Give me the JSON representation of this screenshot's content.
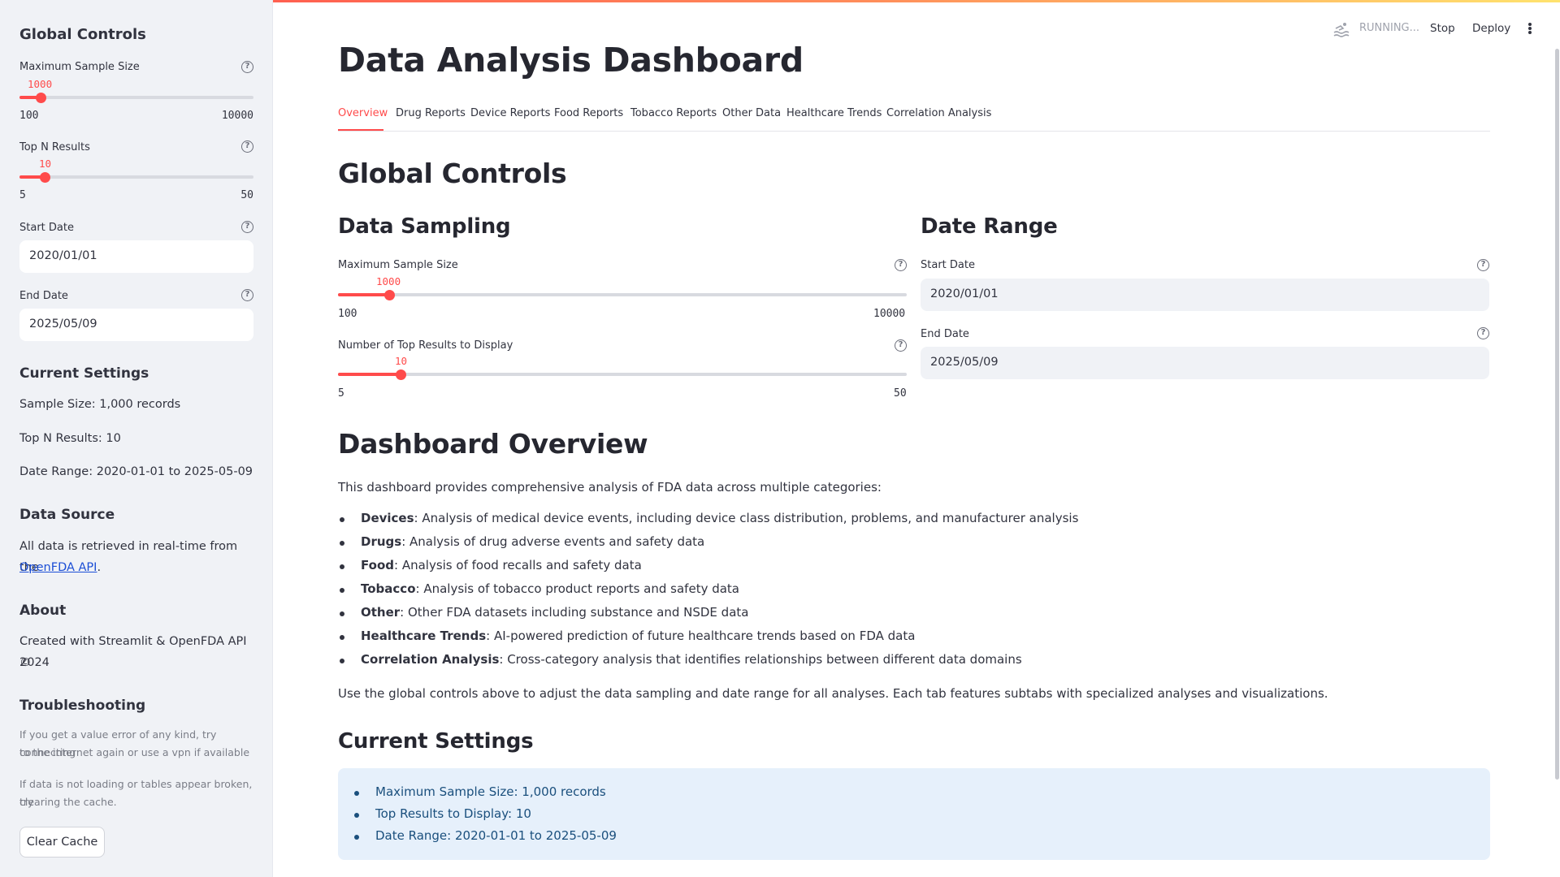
{
  "header": {
    "status": "RUNNING...",
    "stop": "Stop",
    "deploy": "Deploy"
  },
  "sidebar": {
    "title": "Global Controls",
    "max_sample": {
      "label": "Maximum Sample Size",
      "value": "1000",
      "min": "100",
      "max": "10000",
      "fraction": 0.091
    },
    "top_n": {
      "label": "Top N Results",
      "value": "10",
      "min": "5",
      "max": "50",
      "fraction": 0.111
    },
    "start_date": {
      "label": "Start Date",
      "value": "2020/01/01"
    },
    "end_date": {
      "label": "End Date",
      "value": "2025/05/09"
    },
    "current_settings": {
      "title": "Current Settings",
      "sample": "Sample Size: 1,000 records",
      "topn": "Top N Results: 10",
      "range": "Date Range: 2020-01-01 to 2025-05-09"
    },
    "data_source": {
      "title": "Data Source",
      "text": "All data is retrieved in real-time from the",
      "link": "OpenFDA API",
      "after": "."
    },
    "about": {
      "title": "About",
      "line1": "Created with Streamlit & OpenFDA API ©",
      "line2": "2024"
    },
    "troubleshooting": {
      "title": "Troubleshooting",
      "p1a": "If you get a value error of any kind, try connecting",
      "p1b": "to the internet again or use a vpn if available",
      "p2a": "If data is not loading or tables appear broken, try",
      "p2b": "clearing the cache.",
      "button": "Clear Cache"
    }
  },
  "main": {
    "title": "Data Analysis Dashboard",
    "tabs": [
      "Overview",
      "Drug Reports",
      "Device Reports",
      "Food Reports",
      "Tobacco Reports",
      "Other Data",
      "Healthcare Trends",
      "Correlation Analysis"
    ],
    "global_controls": "Global Controls",
    "data_sampling": {
      "title": "Data Sampling",
      "max_sample": {
        "label": "Maximum Sample Size",
        "value": "1000",
        "min": "100",
        "max": "10000",
        "fraction": 0.091
      },
      "top_n": {
        "label": "Number of Top Results to Display",
        "value": "10",
        "min": "5",
        "max": "50",
        "fraction": 0.111
      }
    },
    "date_range": {
      "title": "Date Range",
      "start_label": "Start Date",
      "start_value": "2020/01/01",
      "end_label": "End Date",
      "end_value": "2025/05/09"
    },
    "overview": {
      "title": "Dashboard Overview",
      "intro": "This dashboard provides comprehensive analysis of FDA data across multiple categories:",
      "items": [
        {
          "term": "Devices",
          "desc": ": Analysis of medical device events, including device class distribution, problems, and manufacturer analysis"
        },
        {
          "term": "Drugs",
          "desc": ": Analysis of drug adverse events and safety data"
        },
        {
          "term": "Food",
          "desc": ": Analysis of food recalls and safety data"
        },
        {
          "term": "Tobacco",
          "desc": ": Analysis of tobacco product reports and safety data"
        },
        {
          "term": "Other",
          "desc": ": Other FDA datasets including substance and NSDE data"
        },
        {
          "term": "Healthcare Trends",
          "desc": ": AI-powered prediction of future healthcare trends based on FDA data"
        },
        {
          "term": "Correlation Analysis",
          "desc": ": Cross-category analysis that identifies relationships between different data domains"
        }
      ],
      "outro": "Use the global controls above to adjust the data sampling and date range for all analyses. Each tab features subtabs with specialized analyses and visualizations."
    },
    "current_settings": {
      "title": "Current Settings",
      "items": [
        "Maximum Sample Size: 1,000 records",
        "Top Results to Display: 10",
        "Date Range: 2020-01-01 to 2025-05-09"
      ]
    }
  }
}
